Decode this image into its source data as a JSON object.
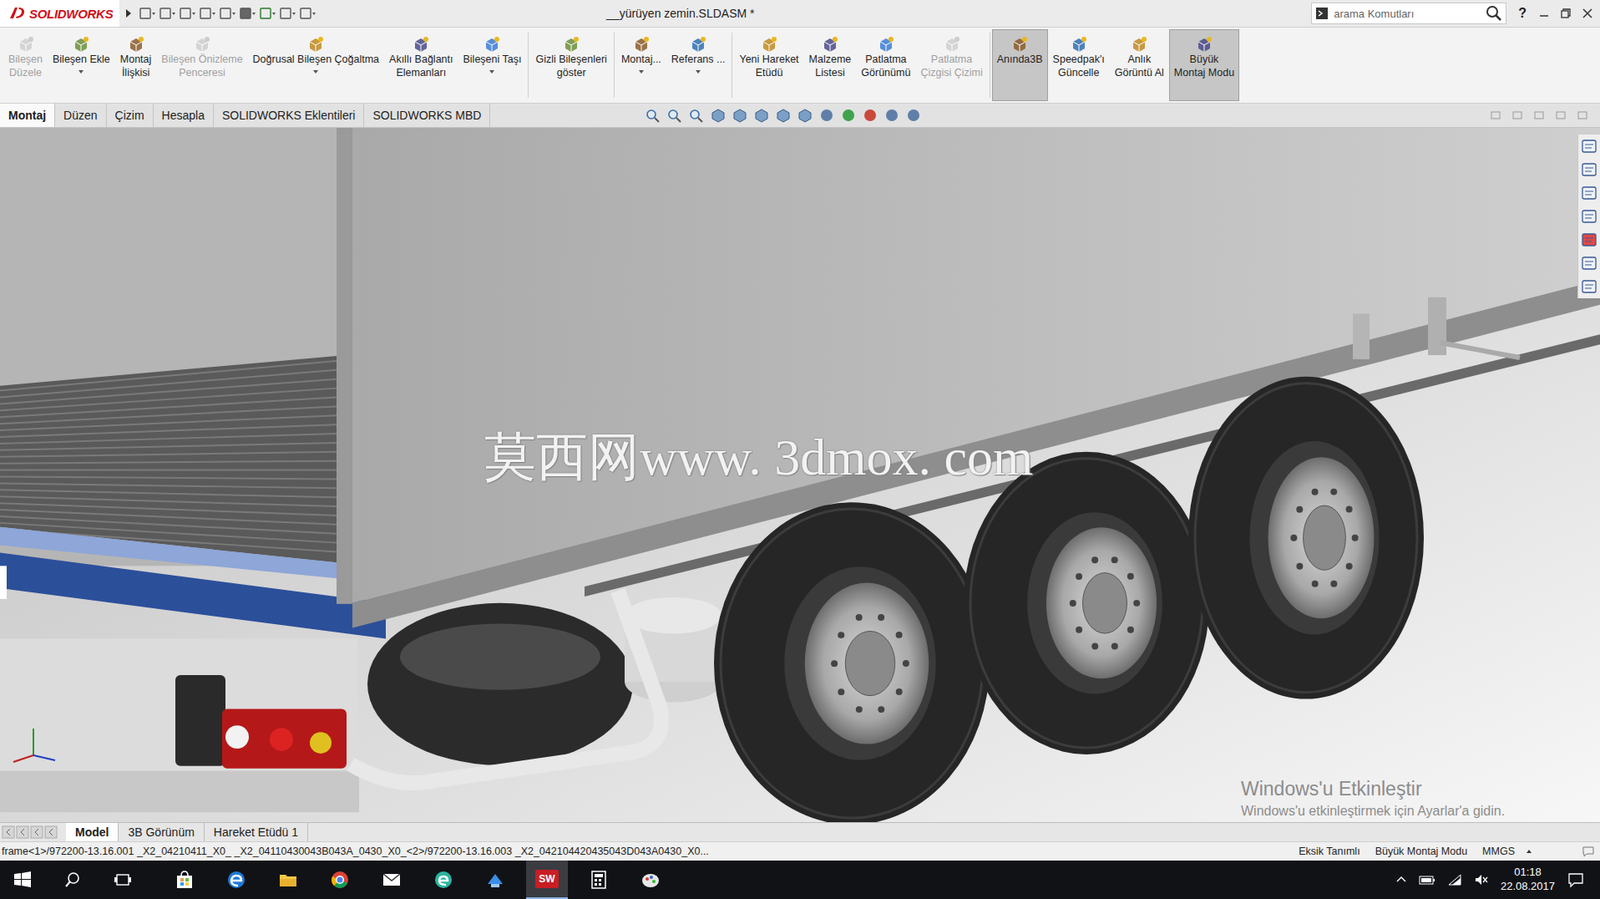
{
  "app": {
    "logo": "SOLIDWORKS",
    "title": "__yürüyen zemin.SLDASM *",
    "search_placeholder": "arama Komutları",
    "help": "?"
  },
  "ribbon": [
    {
      "lines": [
        "Bileşen",
        "Düzele"
      ],
      "disabled": true,
      "selected": false,
      "dropdown": false,
      "group": 1
    },
    {
      "lines": [
        "Bileşen Ekle"
      ],
      "disabled": false,
      "selected": false,
      "dropdown": true,
      "group": 1
    },
    {
      "lines": [
        "Montaj",
        "İlişkisi"
      ],
      "disabled": false,
      "selected": false,
      "dropdown": false,
      "group": 1
    },
    {
      "lines": [
        "Bileşen Önizleme",
        "Penceresi"
      ],
      "disabled": true,
      "selected": false,
      "dropdown": false,
      "group": 1
    },
    {
      "lines": [
        "Doğrusal Bileşen Çoğaltma"
      ],
      "disabled": false,
      "selected": false,
      "dropdown": true,
      "group": 1
    },
    {
      "lines": [
        "Akıllı Bağlantı",
        "Elemanları"
      ],
      "disabled": false,
      "selected": false,
      "dropdown": false,
      "group": 1
    },
    {
      "lines": [
        "Bileşeni Taşı"
      ],
      "disabled": false,
      "selected": false,
      "dropdown": true,
      "group": 1
    },
    {
      "lines": [
        "Gizli Bileşenleri",
        "göster"
      ],
      "disabled": false,
      "selected": false,
      "dropdown": false,
      "group": 2
    },
    {
      "lines": [
        "Montaj..."
      ],
      "disabled": false,
      "selected": false,
      "dropdown": true,
      "group": 3
    },
    {
      "lines": [
        "Referans ..."
      ],
      "disabled": false,
      "selected": false,
      "dropdown": true,
      "group": 3
    },
    {
      "lines": [
        "Yeni Hareket",
        "Etüdü"
      ],
      "disabled": false,
      "selected": false,
      "dropdown": false,
      "group": 4
    },
    {
      "lines": [
        "Malzeme",
        "Listesi"
      ],
      "disabled": false,
      "selected": false,
      "dropdown": false,
      "group": 4
    },
    {
      "lines": [
        "Patlatma",
        "Görünümü"
      ],
      "disabled": false,
      "selected": false,
      "dropdown": false,
      "group": 4
    },
    {
      "lines": [
        "Patlatma",
        "Çizgisi Çizimi"
      ],
      "disabled": true,
      "selected": false,
      "dropdown": false,
      "group": 4
    },
    {
      "lines": [
        "Anında3B"
      ],
      "disabled": false,
      "selected": true,
      "dropdown": false,
      "group": 5
    },
    {
      "lines": [
        "Speedpak'ı",
        "Güncelle"
      ],
      "disabled": false,
      "selected": false,
      "dropdown": false,
      "group": 5
    },
    {
      "lines": [
        "Anlık",
        "Görüntü Al"
      ],
      "disabled": false,
      "selected": false,
      "dropdown": false,
      "group": 5
    },
    {
      "lines": [
        "Büyük",
        "Montaj Modu"
      ],
      "disabled": false,
      "selected": true,
      "dropdown": false,
      "group": 5
    }
  ],
  "command_tabs": [
    {
      "label": "Montaj",
      "selected": true
    },
    {
      "label": "Düzen",
      "selected": false
    },
    {
      "label": "Çizim",
      "selected": false
    },
    {
      "label": "Hesapla",
      "selected": false
    },
    {
      "label": "SOLIDWORKS Eklentileri",
      "selected": false
    },
    {
      "label": "SOLIDWORKS MBD",
      "selected": false
    }
  ],
  "viewport": {
    "watermark": "莫西网www. 3dmox. com",
    "activation_title": "Windows'u Etkinleştir",
    "activation_text": "Windows'u etkinleştirmek için Ayarlar'a gidin."
  },
  "model_tabs": [
    {
      "label": "Model",
      "selected": true
    },
    {
      "label": "3B Görünüm",
      "selected": false
    },
    {
      "label": "Hareket Etüdü 1",
      "selected": false
    }
  ],
  "status_bar": {
    "path": "frame<1>/972200-13.16.001 _X2_04210411_X0_ _X2_04110430043B043A_0430_X0_<2>/972200-13.16.003 _X2_042104420435043D043A0430_X0...",
    "items": [
      "Eksik Tanımlı",
      "Büyük Montaj Modu",
      "MMGS"
    ]
  },
  "taskbar": {
    "apps": [
      {
        "kind": "store",
        "active": false
      },
      {
        "kind": "edge",
        "active": false
      },
      {
        "kind": "explorer",
        "active": false
      },
      {
        "kind": "chrome",
        "active": false
      },
      {
        "kind": "mail",
        "active": false
      },
      {
        "kind": "edge-green",
        "active": false
      },
      {
        "kind": "app",
        "active": false
      },
      {
        "kind": "solidworks",
        "active": true
      },
      {
        "kind": "calculator",
        "active": false
      },
      {
        "kind": "paint",
        "active": false
      }
    ],
    "sw_label": "SW",
    "time": "01:18",
    "date": "22.08.2017"
  }
}
